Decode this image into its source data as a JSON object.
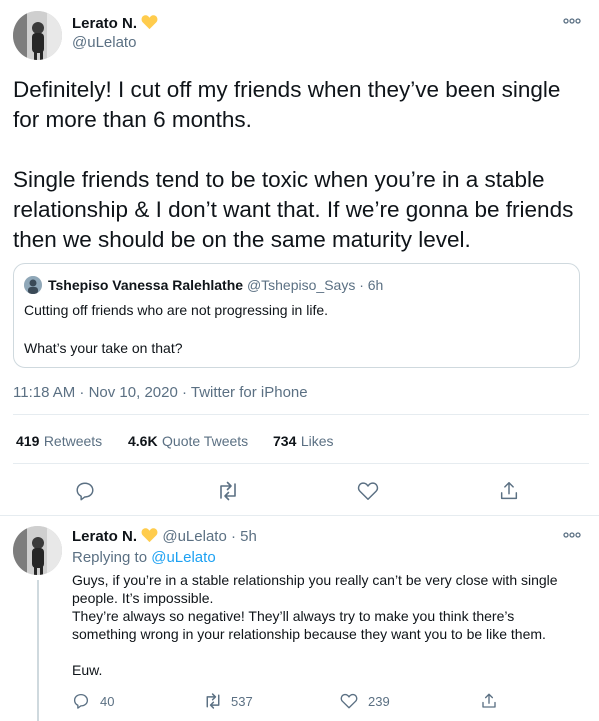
{
  "tweet": {
    "author_name": "Lerato N.",
    "author_handle": "@uLelato",
    "text_p1": "Definitely! I cut off my friends when they’ve been single for more than 6 months.",
    "text_p2": "Single friends tend to be toxic when you’re in a stable relationship & I don’t want that. If we’re gonna be friends then we should be on the same maturity level.",
    "meta": "11:18 AM · Nov 10, 2020 · Twitter for iPhone",
    "stats": {
      "retweets_count": "419",
      "retweets_label": "Retweets",
      "quotes_count": "4.6K",
      "quotes_label": "Quote Tweets",
      "likes_count": "734",
      "likes_label": "Likes"
    }
  },
  "quoted": {
    "author_name": "Tshepiso Vanessa Ralehlathe",
    "author_handle": "@Tshepiso_Says",
    "time": "· 6h",
    "line1": "Cutting off friends who are not progressing in life.",
    "line2": "What’s your take on that?"
  },
  "reply": {
    "author_name": "Lerato N.",
    "author_handle": "@uLelato",
    "time": "· 5h",
    "replying_prefix": "Replying to",
    "replying_to": "@uLelato",
    "lines": [
      "Guys, if you’re in a stable relationship you really can’t be very close with single people. It’s impossible.",
      "They’re always so negative! They’ll always try to make you think there’s something wrong in your relationship because they want you to be like them.",
      "Euw."
    ],
    "counts": {
      "replies": "40",
      "retweets": "537",
      "likes": "239"
    }
  },
  "icons": {
    "verified_heart": "yellow-heart-icon",
    "more": "more-icon",
    "reply": "reply-icon",
    "retweet": "retweet-icon",
    "like": "like-icon",
    "share": "share-icon"
  },
  "colors": {
    "heart": "#ffcc4d",
    "link": "#1da1f2",
    "secondary": "#5b7083",
    "border": "#cfd9de"
  }
}
